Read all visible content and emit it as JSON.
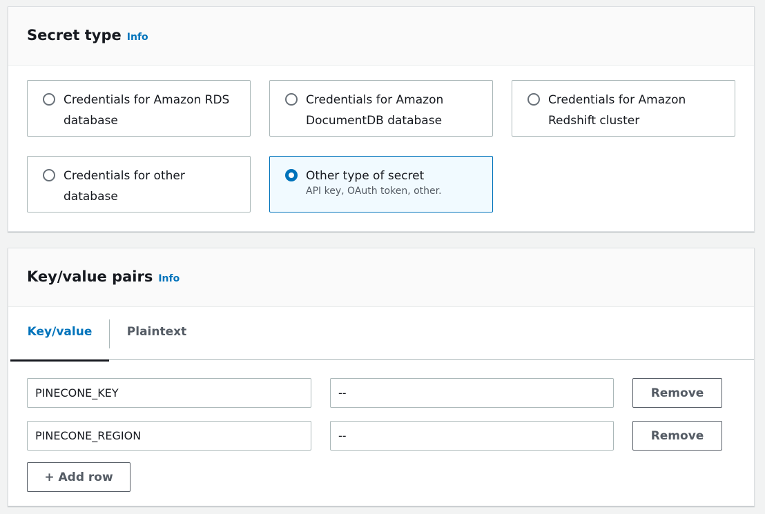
{
  "secret_type": {
    "title": "Secret type",
    "info_label": "Info",
    "options": [
      {
        "label": "Credentials for Amazon RDS database",
        "description": "",
        "selected": false
      },
      {
        "label": "Credentials for Amazon DocumentDB database",
        "description": "",
        "selected": false
      },
      {
        "label": "Credentials for Amazon Redshift cluster",
        "description": "",
        "selected": false
      },
      {
        "label": "Credentials for other database",
        "description": "",
        "selected": false
      },
      {
        "label": "Other type of secret",
        "description": "API key, OAuth token, other.",
        "selected": true
      }
    ]
  },
  "key_value_pairs": {
    "title": "Key/value pairs",
    "info_label": "Info",
    "tabs": [
      {
        "label": "Key/value",
        "active": true
      },
      {
        "label": "Plaintext",
        "active": false
      }
    ],
    "rows": [
      {
        "key": "PINECONE_KEY",
        "value": "--",
        "remove_label": "Remove"
      },
      {
        "key": "PINECONE_REGION",
        "value": "--",
        "remove_label": "Remove"
      }
    ],
    "add_row_label": "+ Add row"
  },
  "colors": {
    "accent": "#0073bb",
    "selected_tile_bg": "#f1faff",
    "page_bg": "#f2f3f3",
    "text": "#16191f",
    "muted_text": "#545b64"
  }
}
